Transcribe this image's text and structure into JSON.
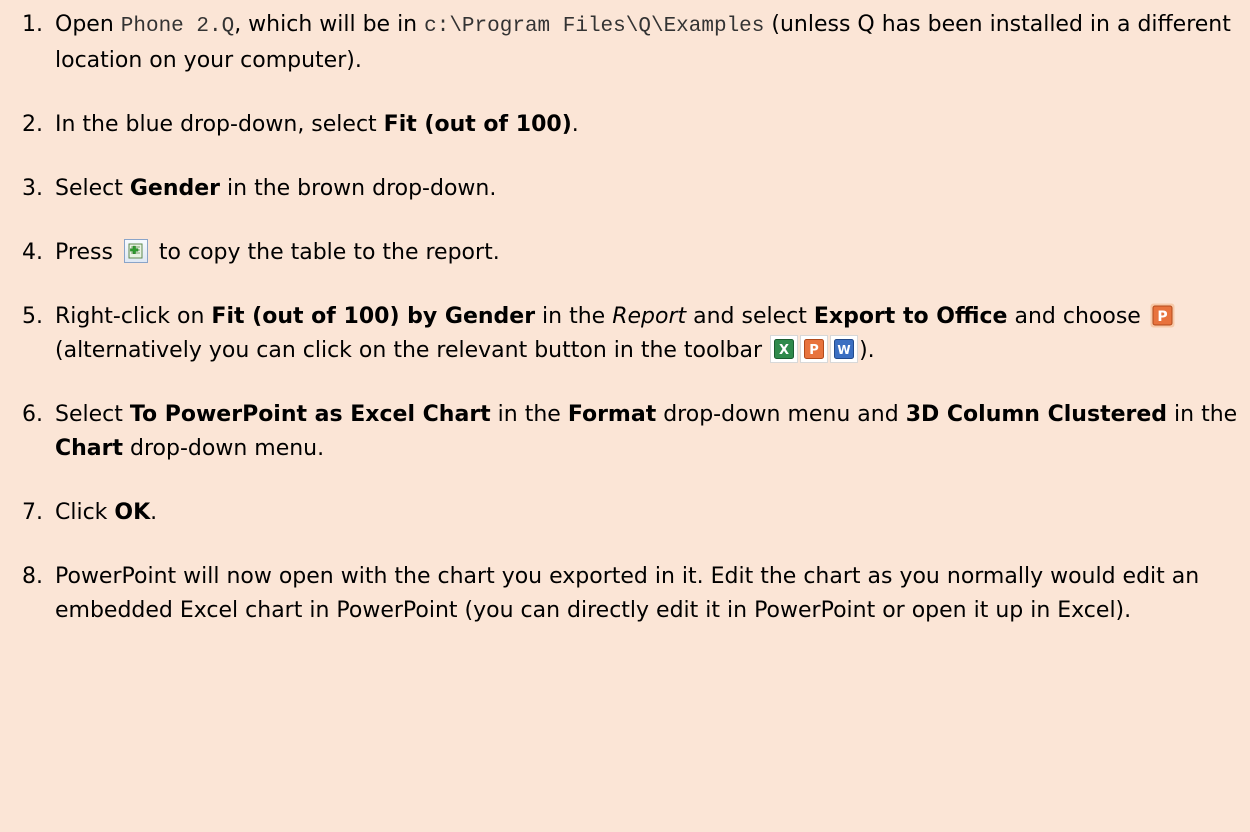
{
  "steps": [
    {
      "number": "1.",
      "parts": {
        "a": "Open ",
        "file": "Phone 2.Q",
        "b": ", which will be in ",
        "path": "c:\\Program Files\\Q\\Examples",
        "c": " (unless Q has been installed in a different location on your computer)."
      }
    },
    {
      "number": "2.",
      "parts": {
        "a": "In the blue drop-down, select ",
        "b": "Fit (out of 100)",
        "c": "."
      }
    },
    {
      "number": "3.",
      "parts": {
        "a": "Select ",
        "b": "Gender",
        "c": " in the brown drop-down."
      }
    },
    {
      "number": "4.",
      "parts": {
        "a": "Press ",
        "b": " to copy the table to the report."
      }
    },
    {
      "number": "5.",
      "parts": {
        "a": "Right-click on ",
        "b": "Fit (out of 100) by Gender",
        "c": " in the ",
        "d": "Report",
        "e": " and select ",
        "f": "Export to Office",
        "g": " and choose ",
        "h": " (alternatively you can click on the relevant button in the toolbar ",
        "i": ")."
      }
    },
    {
      "number": "6.",
      "parts": {
        "a": "Select ",
        "b": "To PowerPoint as Excel Chart",
        "c": " in the ",
        "d": "Format",
        "e": " drop-down menu and ",
        "f": "3D Column Clustered",
        "g": " in the ",
        "h": "Chart",
        "i": " drop-down menu."
      }
    },
    {
      "number": "7.",
      "parts": {
        "a": "Click ",
        "b": "OK",
        "c": "."
      }
    },
    {
      "number": "8.",
      "parts": {
        "a": "PowerPoint will now open with the chart you exported in it. Edit the chart as you normally would edit an embedded Excel chart in PowerPoint (you can directly edit it in PowerPoint or open it up in Excel)."
      }
    }
  ],
  "icons": {
    "add_to_report": "add-to-report-icon",
    "powerpoint": "powerpoint-icon",
    "excel": "excel-icon",
    "word": "word-icon"
  },
  "colors": {
    "background": "#fbe5d6",
    "powerpoint": "#d24726",
    "excel": "#1f7244",
    "word": "#2b579a"
  }
}
